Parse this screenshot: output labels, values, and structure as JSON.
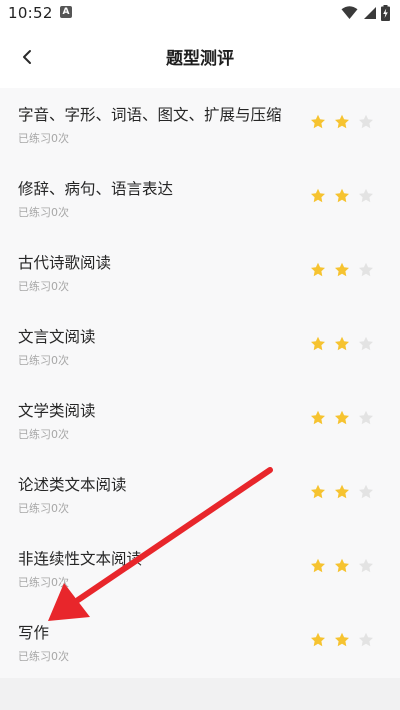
{
  "status_bar": {
    "time": "10:52",
    "notification_letter": "A"
  },
  "header": {
    "title": "题型测评"
  },
  "items": [
    {
      "title": "字音、字形、词语、图文、扩展与压缩",
      "subtitle": "已练习0次",
      "rating": 2,
      "max_rating": 3
    },
    {
      "title": "修辞、病句、语言表达",
      "subtitle": "已练习0次",
      "rating": 2,
      "max_rating": 3
    },
    {
      "title": "古代诗歌阅读",
      "subtitle": "已练习0次",
      "rating": 2,
      "max_rating": 3
    },
    {
      "title": "文言文阅读",
      "subtitle": "已练习0次",
      "rating": 2,
      "max_rating": 3
    },
    {
      "title": "文学类阅读",
      "subtitle": "已练习0次",
      "rating": 2,
      "max_rating": 3
    },
    {
      "title": "论述类文本阅读",
      "subtitle": "已练习0次",
      "rating": 2,
      "max_rating": 3
    },
    {
      "title": "非连续性文本阅读",
      "subtitle": "已练习0次",
      "rating": 2,
      "max_rating": 3
    },
    {
      "title": "写作",
      "subtitle": "已练习0次",
      "rating": 2,
      "max_rating": 3
    }
  ],
  "colors": {
    "star_filled": "#f6c330",
    "star_empty": "#e3e3e3",
    "annotation_arrow": "#e8262b"
  },
  "icons": {
    "back": "chevron-left-icon",
    "wifi": "wifi-icon",
    "signal": "signal-icon",
    "battery": "battery-charging-icon"
  }
}
